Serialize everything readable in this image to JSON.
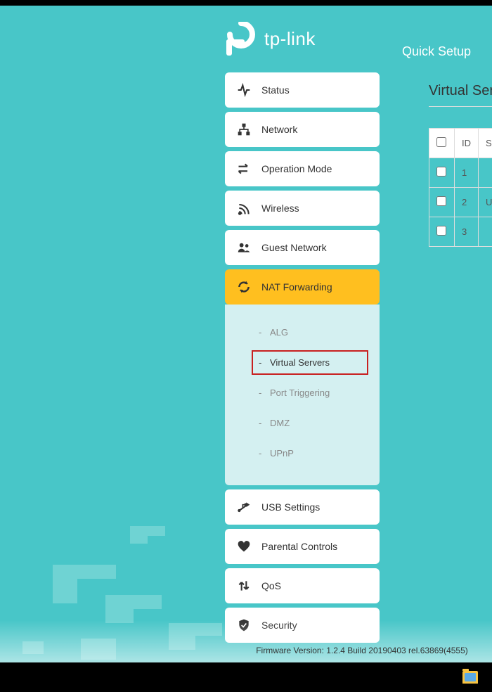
{
  "brand": "tp-link",
  "header": {
    "quick_setup": "Quick Setup"
  },
  "sidebar": {
    "items": [
      {
        "label": "Status"
      },
      {
        "label": "Network"
      },
      {
        "label": "Operation Mode"
      },
      {
        "label": "Wireless"
      },
      {
        "label": "Guest Network"
      },
      {
        "label": "NAT Forwarding",
        "active": true
      },
      {
        "label": "USB Settings"
      },
      {
        "label": "Parental Controls"
      },
      {
        "label": "QoS"
      },
      {
        "label": "Security"
      }
    ],
    "submenu": [
      {
        "label": "ALG"
      },
      {
        "label": "Virtual Servers",
        "selected": true
      },
      {
        "label": "Port Triggering"
      },
      {
        "label": "DMZ"
      },
      {
        "label": "UPnP"
      }
    ]
  },
  "main": {
    "title": "Virtual Serv",
    "table": {
      "headers": {
        "id": "ID",
        "service": "Se"
      },
      "rows": [
        {
          "id": "1",
          "service": ""
        },
        {
          "id": "2",
          "service": "Upl"
        },
        {
          "id": "3",
          "service": ""
        }
      ]
    }
  },
  "footer": {
    "firmware_label": "Firmware Version:",
    "firmware_value": "1.2.4 Build 20190403 rel.63869(4555)"
  }
}
